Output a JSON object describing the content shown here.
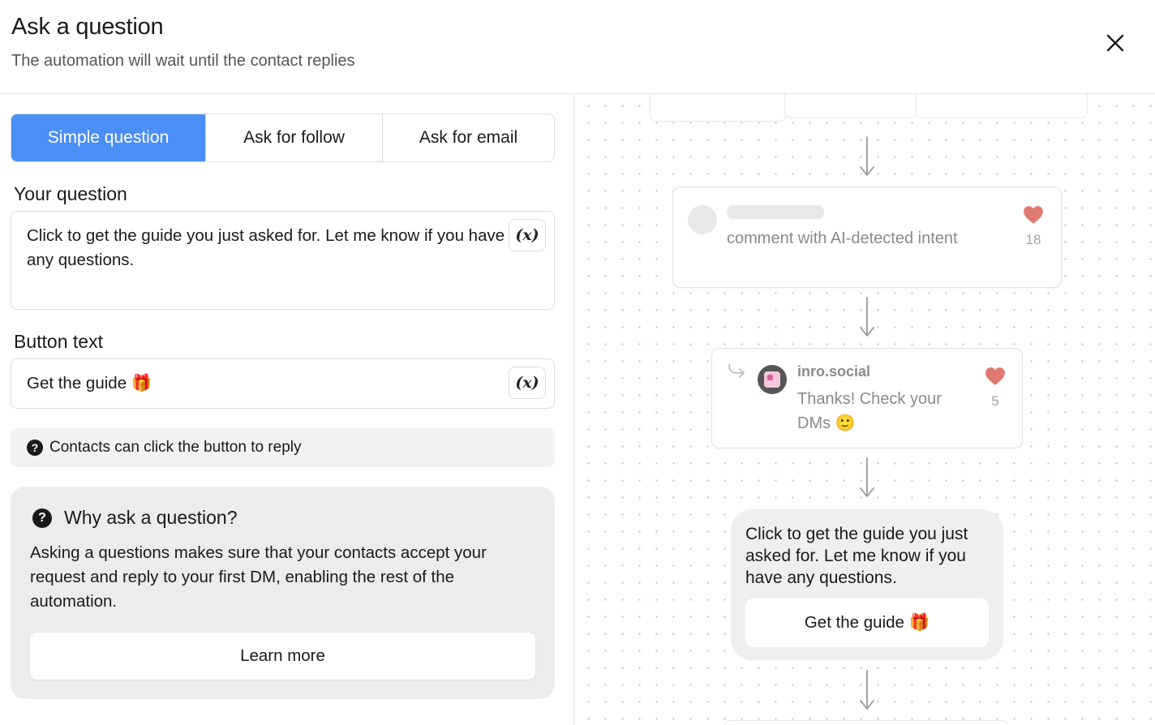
{
  "header": {
    "title": "Ask a question",
    "subtitle": "The automation will wait until the contact replies"
  },
  "tabs": [
    {
      "label": "Simple question",
      "active": true
    },
    {
      "label": "Ask for follow",
      "active": false
    },
    {
      "label": "Ask for email",
      "active": false
    }
  ],
  "question": {
    "label": "Your question",
    "value": "Click to get the guide you just asked for. Let me know if you have any questions.",
    "variable_button": "(x)"
  },
  "button_text": {
    "label": "Button text",
    "value": "Get the guide 🎁",
    "variable_button": "(x)"
  },
  "hint": {
    "icon": "question-circle-icon",
    "text": "Contacts can click the button to reply"
  },
  "info": {
    "icon": "question-circle-icon",
    "title": "Why ask a question?",
    "body": "Asking a questions makes sure that your contacts accept your request and reply to your first DM, enabling the rest of the automation.",
    "button": "Learn more"
  },
  "preview": {
    "comment_node": {
      "text": "comment with AI-detected intent",
      "likes": "18"
    },
    "reply_node": {
      "username": "inro.social",
      "text": "Thanks! Check your DMs 🙂",
      "likes": "5"
    },
    "message_bubble": {
      "text": "Click to get the guide you just asked for. Let me know if you have any questions.",
      "button": "Get the guide 🎁"
    }
  },
  "colors": {
    "accent": "#4b8ef5",
    "heart": "#e07a72",
    "hint_bg": "#f2f2f2",
    "info_bg": "#ececec"
  }
}
